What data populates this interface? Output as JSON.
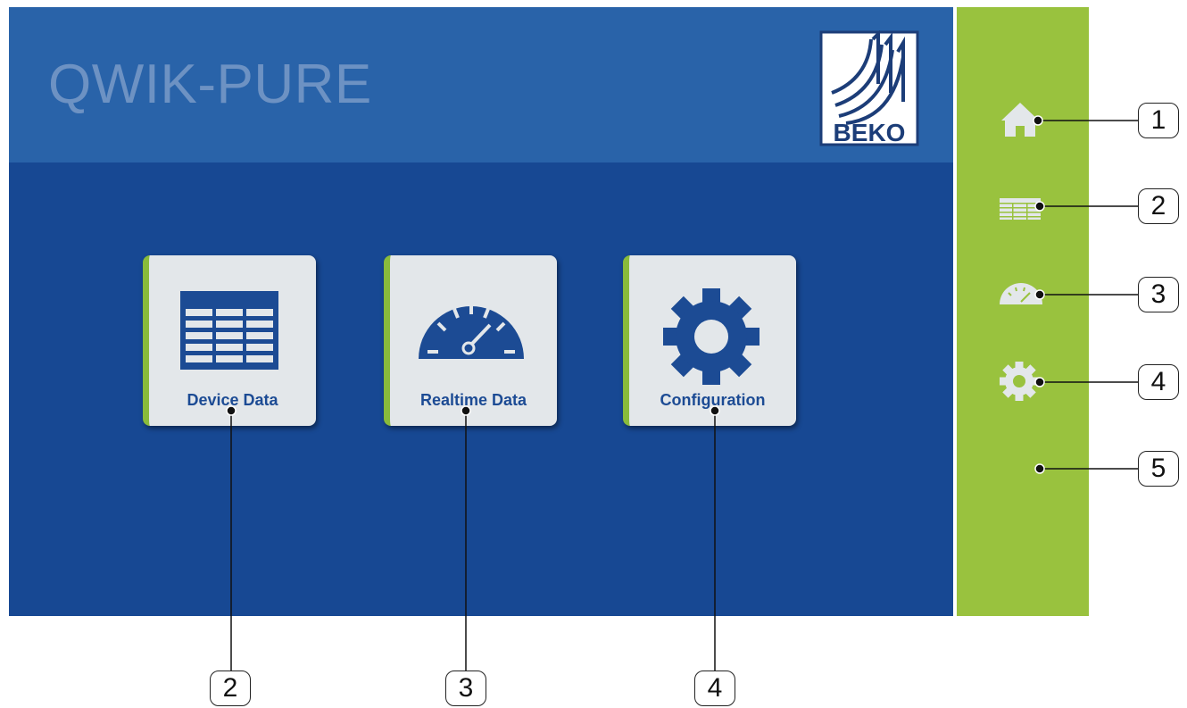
{
  "app": {
    "title": "QWIK-PURE",
    "brand": "BEKO"
  },
  "colors": {
    "header": "#2963a9",
    "body": "#174893",
    "sidebar": "#99c23e",
    "tile": "#e3e7ea",
    "tile_accent": "#89bb3b",
    "tile_text": "#1c4b94"
  },
  "tiles": [
    {
      "label": "Device Data",
      "icon": "table-icon"
    },
    {
      "label": "Realtime Data",
      "icon": "gauge-icon"
    },
    {
      "label": "Configuration",
      "icon": "gear-icon"
    }
  ],
  "sidebar": {
    "items": [
      {
        "icon": "home-icon"
      },
      {
        "icon": "table-icon"
      },
      {
        "icon": "gauge-icon"
      },
      {
        "icon": "gear-icon"
      }
    ]
  },
  "callouts": {
    "right": [
      "1",
      "2",
      "3",
      "4",
      "5"
    ],
    "bottom": [
      "2",
      "3",
      "4"
    ]
  }
}
